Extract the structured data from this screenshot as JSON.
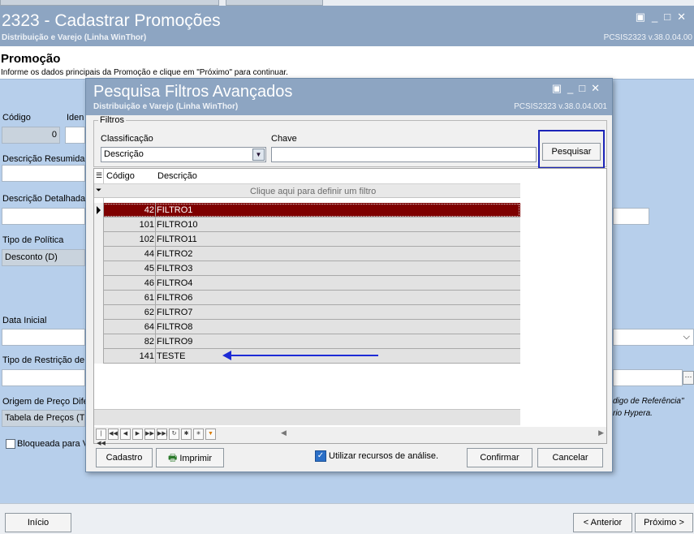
{
  "main": {
    "title": "2323 - Cadastrar Promoções",
    "subtitle": "Distribuição e Varejo (Linha WinThor)",
    "version": "PCSIS2323  v.38.0.04.00",
    "window_controls": [
      "▣",
      "_",
      "□",
      "✕"
    ],
    "section_title": "Promoção",
    "section_sub": "Informe os dados principais da Promoção e clique em \"Próximo\" para continuar.",
    "labels": {
      "codigo": "Código",
      "ident": "Iden",
      "descricao_resumida": "Descrição Resumida",
      "descricao_detalhada": "Descrição Detalhada",
      "tipo_politica": "Tipo de Política",
      "data_inicial": "Data Inicial",
      "tipo_restricao": "Tipo de Restrição de",
      "origem_preco": "Origem de Preço Difer",
      "bloqueada": "Bloqueada para V"
    },
    "values": {
      "codigo": "0",
      "tipo_politica": "Desconto (D)",
      "origem_preco": "Tabela de Preços (T)"
    },
    "side_notes": [
      "digo de Referência\"",
      "rio Hypera."
    ],
    "buttons": {
      "inicio": "Início",
      "anterior": "< Anterior",
      "proximo": "Próximo >"
    }
  },
  "dialog": {
    "title": "Pesquisa Filtros Avançados",
    "subtitle": "Distribuição e Varejo (Linha WinThor)",
    "version": "PCSIS2323  v.38.0.04.001",
    "window_controls": [
      "▣",
      "_",
      "□",
      "✕"
    ],
    "filters": {
      "group_label": "Filtros",
      "classificacao_label": "Classificação",
      "classificacao_value": "Descrição",
      "chave_label": "Chave",
      "chave_value": "",
      "search_button": "Pesquisar"
    },
    "grid": {
      "columns": [
        "Código",
        "Descrição"
      ],
      "filter_hint": "Clique aqui para definir um filtro",
      "rows": [
        {
          "codigo": "42",
          "descricao": "FILTRO1"
        },
        {
          "codigo": "101",
          "descricao": "FILTRO10"
        },
        {
          "codigo": "102",
          "descricao": "FILTRO11"
        },
        {
          "codigo": "44",
          "descricao": "FILTRO2"
        },
        {
          "codigo": "45",
          "descricao": "FILTRO3"
        },
        {
          "codigo": "46",
          "descricao": "FILTRO4"
        },
        {
          "codigo": "61",
          "descricao": "FILTRO6"
        },
        {
          "codigo": "62",
          "descricao": "FILTRO7"
        },
        {
          "codigo": "64",
          "descricao": "FILTRO8"
        },
        {
          "codigo": "82",
          "descricao": "FILTRO9"
        },
        {
          "codigo": "141",
          "descricao": "TESTE"
        }
      ],
      "selected_row": 0
    },
    "buttons": {
      "cadastro": "Cadastro",
      "imprimir": "Imprimir",
      "usar_analise": "Utilizar recursos de análise.",
      "confirmar": "Confirmar",
      "cancelar": "Cancelar"
    },
    "colors": {
      "title_bar": "#8da5c2",
      "selected_row": "#7e0000",
      "annotation": "#1d2bd6"
    }
  }
}
